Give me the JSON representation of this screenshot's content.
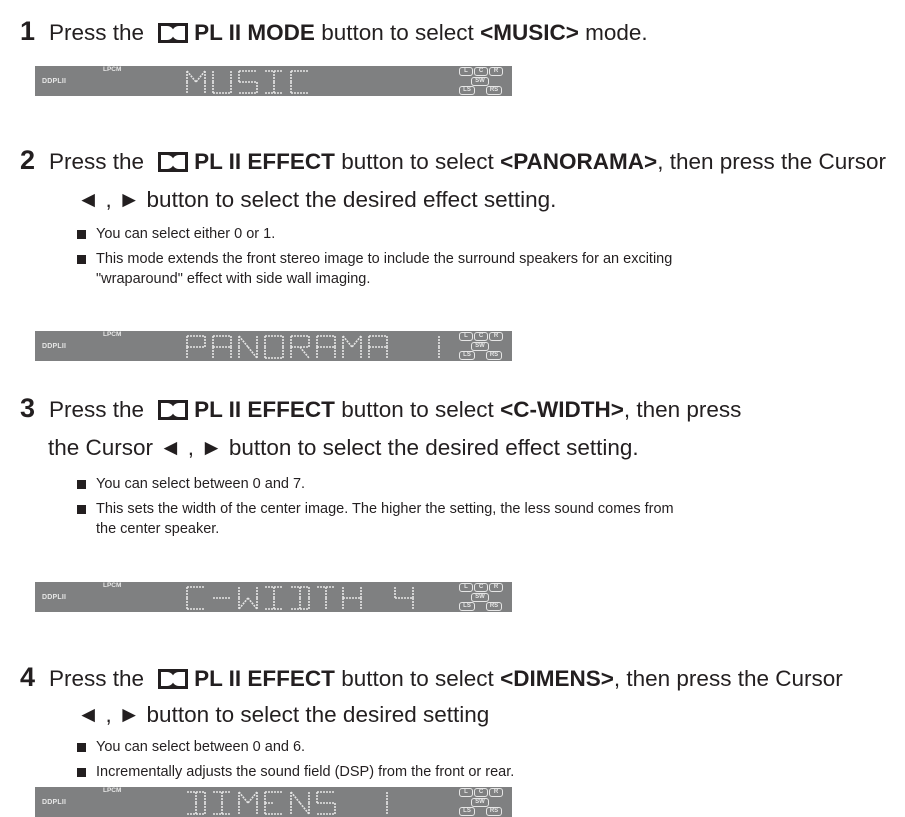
{
  "steps": [
    {
      "number": "1",
      "line1_pre": "Press the",
      "button": "PL II MODE",
      "line1_mid": "button to select",
      "option": "<MUSIC>",
      "line1_post": "mode.",
      "line2": "",
      "bullets": [],
      "display": {
        "text": "MUSIC",
        "chars": [
          "M",
          "U",
          "S",
          "I",
          "C",
          "",
          "",
          "",
          "",
          ""
        ]
      }
    },
    {
      "number": "2",
      "line1_pre": "Press the",
      "button": "PL II EFFECT",
      "line1_mid": "button to select",
      "option": "<PANORAMA>",
      "line1_post": ", then press the Cursor",
      "line2": "◄ , ► button to select the desired effect setting.",
      "bullets": [
        "You can select either 0 or 1.",
        "This mode extends the front stereo image to include the surround speakers for an exciting\n\"wraparound\" effect with side wall imaging."
      ],
      "display": {
        "text": "PANORAMA 1",
        "chars": [
          "P",
          "A",
          "N",
          "O",
          "R",
          "A",
          "M",
          "A",
          "",
          "1"
        ]
      }
    },
    {
      "number": "3",
      "line1_pre": "Press the",
      "button": "PL II EFFECT",
      "line1_mid": "button to select",
      "option": "<C-WIDTH>",
      "line1_post": ", then press",
      "line2": "the Cursor ◄ , ► button to select the desired effect setting.",
      "bullets": [
        "You can select between 0 and 7.",
        "This sets the width of the center image. The higher the setting, the less sound comes from\nthe center speaker."
      ],
      "display": {
        "text": "C-WIDTH 4",
        "chars": [
          "C",
          "-",
          "W",
          "I",
          "D",
          "T",
          "H",
          "",
          "4",
          ""
        ]
      }
    },
    {
      "number": "4",
      "line1_pre": "Press the",
      "button": "PL II EFFECT",
      "line1_mid": "button to select",
      "option": "<DIMENS>",
      "line1_post": ", then press the Cursor",
      "line2": "◄ , ► button to select the desired setting",
      "bullets": [
        "You can select between 0 and 6.",
        "Incrementally adjusts the sound field (DSP) from the front or rear."
      ],
      "display": {
        "text": "DIMENS 1",
        "chars": [
          "D",
          "I",
          "M",
          "E",
          "N",
          "S",
          "",
          "1",
          "",
          ""
        ]
      }
    }
  ],
  "lcd_labels": {
    "lpcm": "LPCM",
    "dolby_pl": "DDPLII",
    "channels": {
      "L": "L",
      "C": "C",
      "R": "R",
      "SW": "SW",
      "LS": "LS",
      "RS": "RS"
    }
  },
  "colors": {
    "text": "#231f20",
    "lcd_bg": "#7f8081",
    "lcd_segment": "#e6e6e6"
  }
}
